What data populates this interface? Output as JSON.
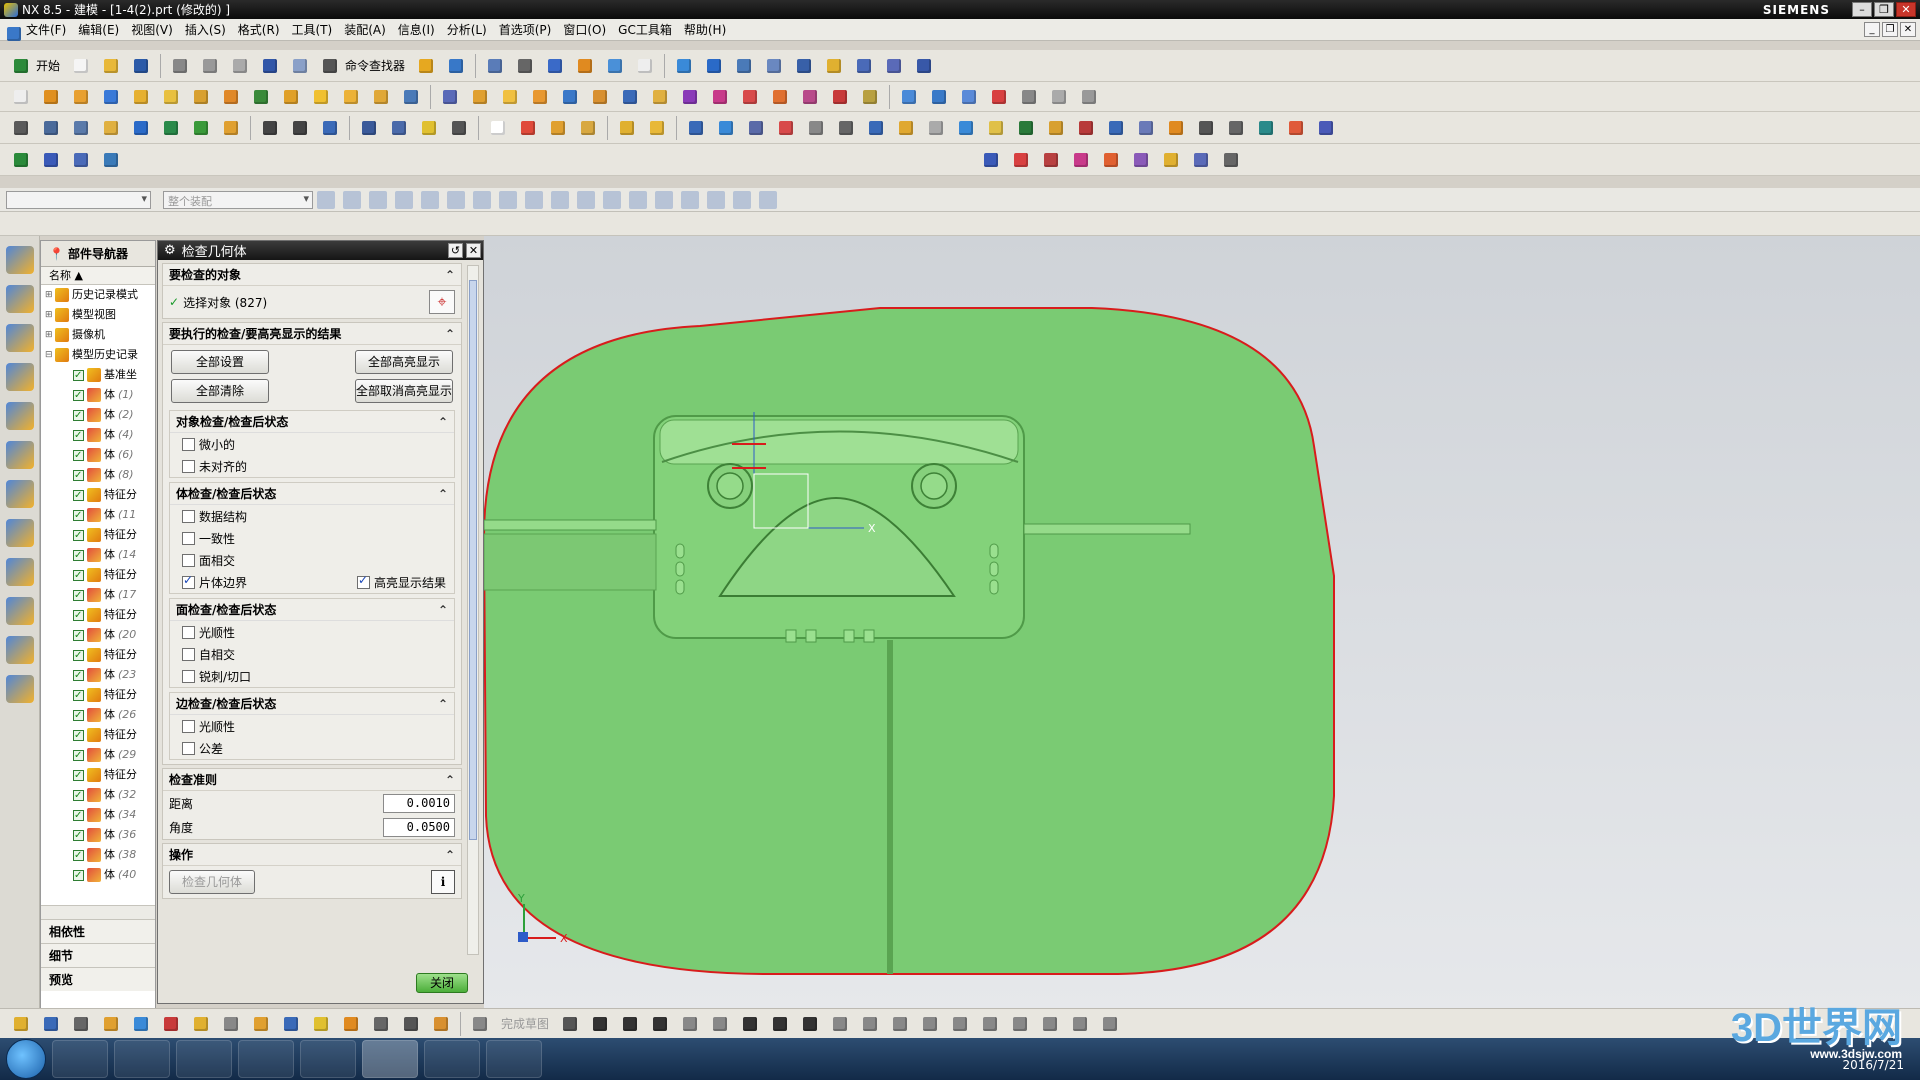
{
  "window": {
    "title": "NX 8.5 - 建模 - [1-4(2).prt  (修改的) ]",
    "brand": "SIEMENS",
    "controls": [
      "–",
      "❐",
      "✕"
    ]
  },
  "menu": [
    "文件(F)",
    "编辑(E)",
    "视图(V)",
    "插入(S)",
    "格式(R)",
    "工具(T)",
    "装配(A)",
    "信息(I)",
    "分析(L)",
    "首选项(P)",
    "窗口(O)",
    "GC工具箱",
    "帮助(H)"
  ],
  "toolbar": {
    "start_label": "开始",
    "command_finder": "命令查找器"
  },
  "selection_bar": {
    "filter_placeholder": "",
    "scope": "整个装配"
  },
  "navigator": {
    "title": "部件导航器",
    "column": "名称",
    "items": [
      {
        "label": "历史记录模式",
        "idx": "",
        "type": "root"
      },
      {
        "label": "模型视图",
        "idx": "",
        "type": "root"
      },
      {
        "label": "摄像机",
        "idx": "",
        "type": "root"
      },
      {
        "label": "模型历史记录",
        "idx": "",
        "type": "root"
      },
      {
        "label": "基准坐",
        "idx": "",
        "type": "feat"
      },
      {
        "label": "体",
        "idx": "(1)",
        "type": "body"
      },
      {
        "label": "体",
        "idx": "(2)",
        "type": "body"
      },
      {
        "label": "体",
        "idx": "(4)",
        "type": "body"
      },
      {
        "label": "体",
        "idx": "(6)",
        "type": "body"
      },
      {
        "label": "体",
        "idx": "(8)",
        "type": "body"
      },
      {
        "label": "特征分",
        "idx": "",
        "type": "feat"
      },
      {
        "label": "体",
        "idx": "(11",
        "type": "body"
      },
      {
        "label": "特征分",
        "idx": "",
        "type": "feat"
      },
      {
        "label": "体",
        "idx": "(14",
        "type": "body"
      },
      {
        "label": "特征分",
        "idx": "",
        "type": "feat"
      },
      {
        "label": "体",
        "idx": "(17",
        "type": "body"
      },
      {
        "label": "特征分",
        "idx": "",
        "type": "feat"
      },
      {
        "label": "体",
        "idx": "(20",
        "type": "body"
      },
      {
        "label": "特征分",
        "idx": "",
        "type": "feat"
      },
      {
        "label": "体",
        "idx": "(23",
        "type": "body"
      },
      {
        "label": "特征分",
        "idx": "",
        "type": "feat"
      },
      {
        "label": "体",
        "idx": "(26",
        "type": "body"
      },
      {
        "label": "特征分",
        "idx": "",
        "type": "feat"
      },
      {
        "label": "体",
        "idx": "(29",
        "type": "body"
      },
      {
        "label": "特征分",
        "idx": "",
        "type": "feat"
      },
      {
        "label": "体",
        "idx": "(32",
        "type": "body"
      },
      {
        "label": "体",
        "idx": "(34",
        "type": "body"
      },
      {
        "label": "体",
        "idx": "(36",
        "type": "body"
      },
      {
        "label": "体",
        "idx": "(38",
        "type": "body"
      },
      {
        "label": "体",
        "idx": "(40",
        "type": "body"
      }
    ],
    "sections": [
      "相依性",
      "细节",
      "预览"
    ]
  },
  "dialog": {
    "title": "检查几何体",
    "objects_group": "要检查的对象",
    "select_objects": "选择对象 (827)",
    "checks_group": "要执行的检查/要高亮显示的结果",
    "btn_set_all": "全部设置",
    "btn_highlight_all": "全部高亮显示",
    "btn_clear_all": "全部清除",
    "btn_unhighlight_all": "全部取消高亮显示",
    "object_checks": {
      "title": "对象检查/检查后状态",
      "items": [
        "微小的",
        "未对齐的"
      ]
    },
    "body_checks": {
      "title": "体检查/检查后状态",
      "items": [
        "数据结构",
        "一致性",
        "面相交",
        "片体边界"
      ],
      "highlight_label": "高亮显示结果"
    },
    "face_checks": {
      "title": "面检查/检查后状态",
      "items": [
        "光顺性",
        "自相交",
        "锐刺/切口"
      ]
    },
    "edge_checks": {
      "title": "边检查/检查后状态",
      "items": [
        "光顺性",
        "公差"
      ]
    },
    "criteria": {
      "title": "检查准则",
      "distance_label": "距离",
      "distance_value": "0.0010",
      "angle_label": "角度",
      "angle_value": "0.0500"
    },
    "operation_title": "操作",
    "check_button": "检查几何体",
    "close_button": "关闭"
  },
  "graphics": {
    "wcs_x_label": "X",
    "triad_x_label": "X",
    "triad_y_label": "Y",
    "body_color": "#74c474"
  },
  "bottom_toolbar": {
    "finish_sketch": "完成草图"
  },
  "watermark": {
    "text": "3D世界网",
    "url": "www.3dsjw.com"
  },
  "clock": {
    "date": "2016/7/21"
  }
}
